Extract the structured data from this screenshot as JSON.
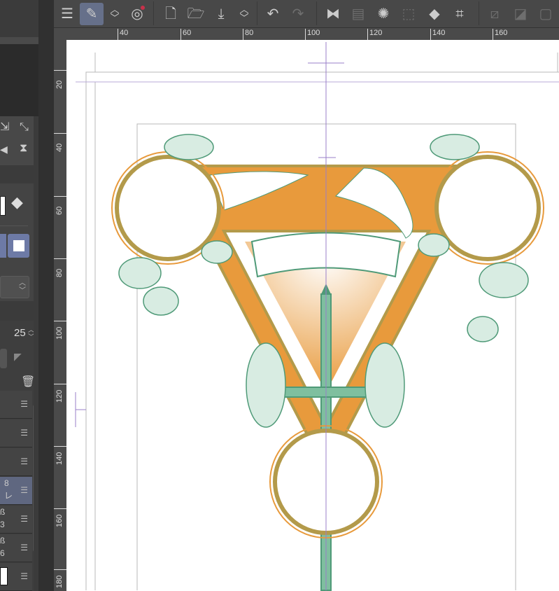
{
  "toolbar": {
    "items": [
      "menu-icon",
      "object-tool-icon",
      "toggle-icon",
      "cloud-icon",
      "new-canvas-icon",
      "open-icon",
      "save-icon",
      "toggle2-icon",
      "undo-icon",
      "redo-icon",
      "flip-horizontal-icon",
      "layer-settings-icon",
      "loading-spinner-icon",
      "selection-icon",
      "fill-icon",
      "transform-icon",
      "deselect-icon",
      "invert-selection-icon",
      "selection-border-icon"
    ],
    "expand_label": "»"
  },
  "rulers": {
    "horizontal": [
      "40",
      "60",
      "80",
      "100",
      "120",
      "140",
      "160"
    ],
    "vertical": [
      "20",
      "40",
      "60",
      "80",
      "100",
      "120",
      "140",
      "160",
      "180"
    ]
  },
  "left_panel": {
    "opacity_value": "25",
    "layer_fragments": [
      "8",
      "レ",
      "ß",
      "3",
      "ß",
      "6"
    ]
  },
  "colors": {
    "accent": "#66708a",
    "orange": "#e89a3c",
    "green": "#4f9a78",
    "gold": "#b39a4a",
    "guide": "#9a7fc8"
  }
}
